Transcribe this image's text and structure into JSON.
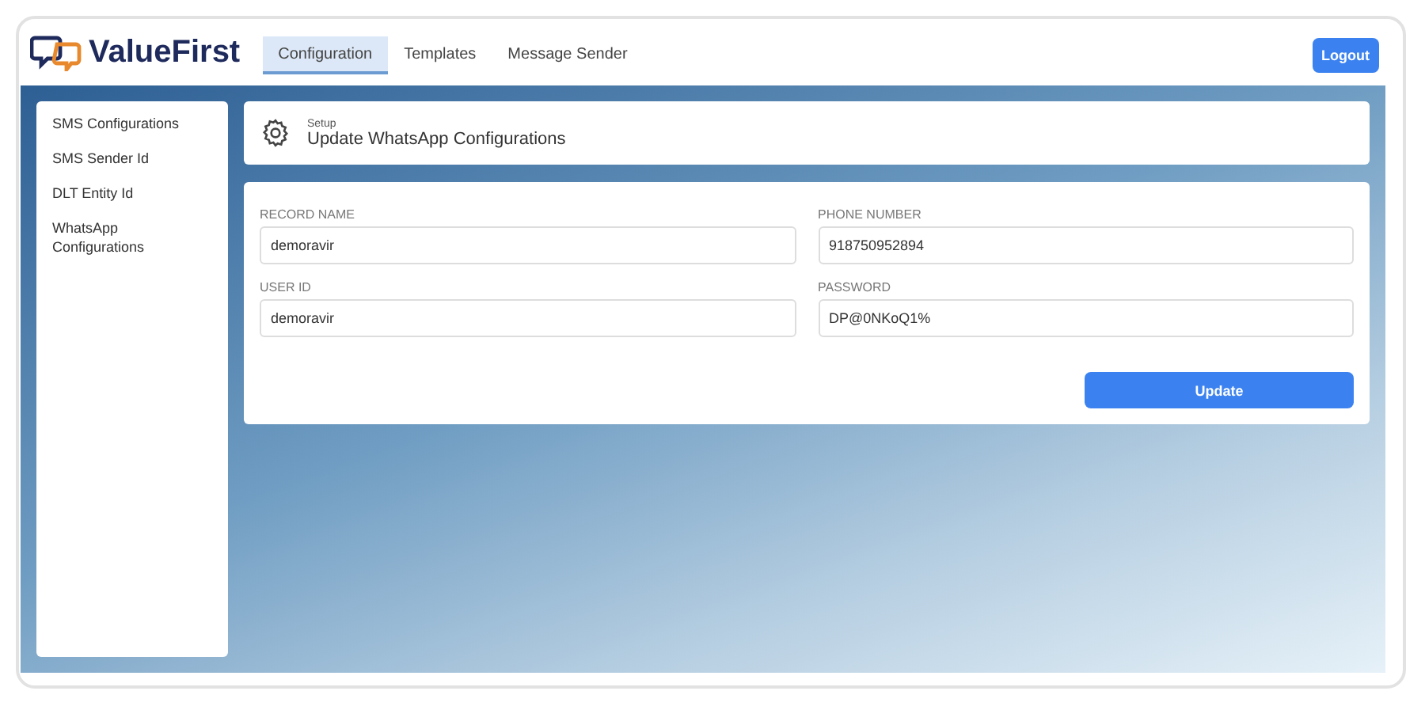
{
  "brand": "ValueFirst",
  "tabs": [
    {
      "label": "Configuration",
      "selected": true
    },
    {
      "label": "Templates",
      "selected": false
    },
    {
      "label": "Message Sender",
      "selected": false
    }
  ],
  "logout": "Logout",
  "sidebar": {
    "items": [
      "SMS Configurations",
      "SMS Sender Id",
      "DLT Entity Id",
      "WhatsApp Configurations"
    ]
  },
  "header": {
    "eyebrow": "Setup",
    "title": "Update WhatsApp Configurations"
  },
  "fields": [
    {
      "label": "RECORD NAME",
      "value": "demoravir"
    },
    {
      "label": "PHONE NUMBER",
      "value": "918750952894"
    },
    {
      "label": "USER ID",
      "value": "demoravir"
    },
    {
      "label": "PASSWORD",
      "value": "DP@0NKoQ1%"
    }
  ],
  "submit": "Update"
}
